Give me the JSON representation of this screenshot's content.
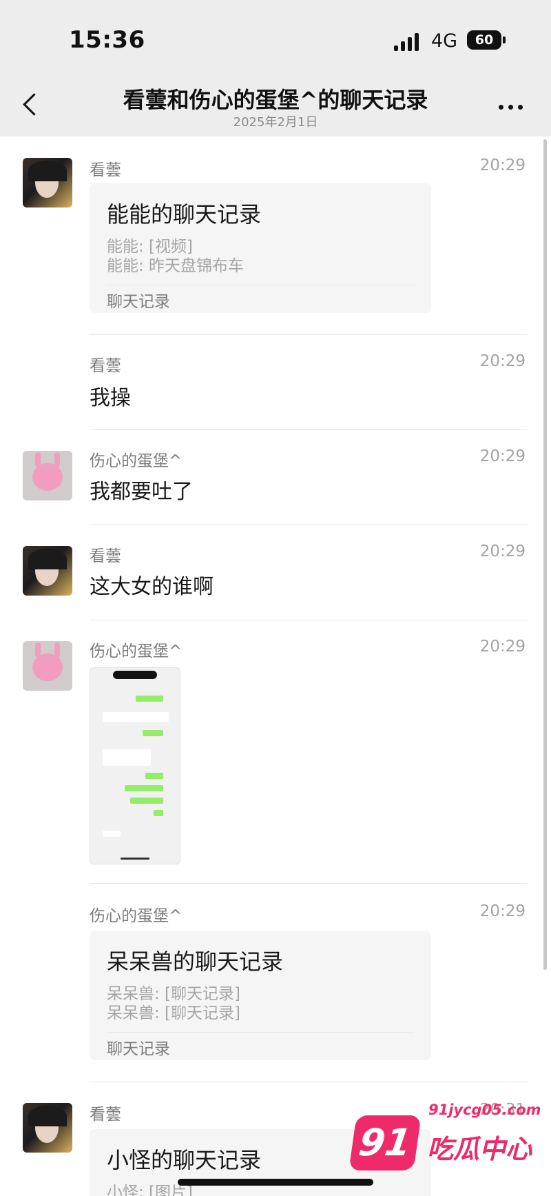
{
  "status_bar": {
    "time": "15:36",
    "network": "4G",
    "battery": "60"
  },
  "header": {
    "title": "看蕓和伤心的蛋堡^的聊天记录",
    "subtitle": "2025年2月1日"
  },
  "messages": [
    {
      "sender": "看蕓",
      "time": "20:29",
      "card": {
        "title": "能能的聊天记录",
        "lines": [
          "能能: [视频]",
          "能能: 昨天盘锦布车"
        ],
        "footer": "聊天记录"
      }
    },
    {
      "sender": "看蕓",
      "time": "20:29",
      "text": "我操"
    },
    {
      "sender": "伤心的蛋堡^",
      "time": "20:29",
      "text": "我都要吐了"
    },
    {
      "sender": "看蕓",
      "time": "20:29",
      "text": "这大女的谁啊"
    },
    {
      "sender": "伤心的蛋堡^",
      "time": "20:29"
    },
    {
      "sender": "伤心的蛋堡^",
      "time": "20:29",
      "card": {
        "title": "呆呆兽的聊天记录",
        "lines": [
          "呆呆兽: [聊天记录]",
          "呆呆兽: [聊天记录]"
        ],
        "footer": "聊天记录"
      }
    },
    {
      "sender": "看蕓",
      "time": "20:31",
      "card": {
        "title": "小怪的聊天记录",
        "lines": [
          "小怪: [图片]"
        ]
      }
    }
  ],
  "watermark": {
    "url": "91jycg05.com",
    "logo": "91",
    "brand": "吃瓜中心"
  },
  "colors": {
    "header_bg": "#ededed",
    "card_bg": "#f5f5f5",
    "watermark": "#ef2a6b",
    "chat_green": "#95ec69"
  }
}
